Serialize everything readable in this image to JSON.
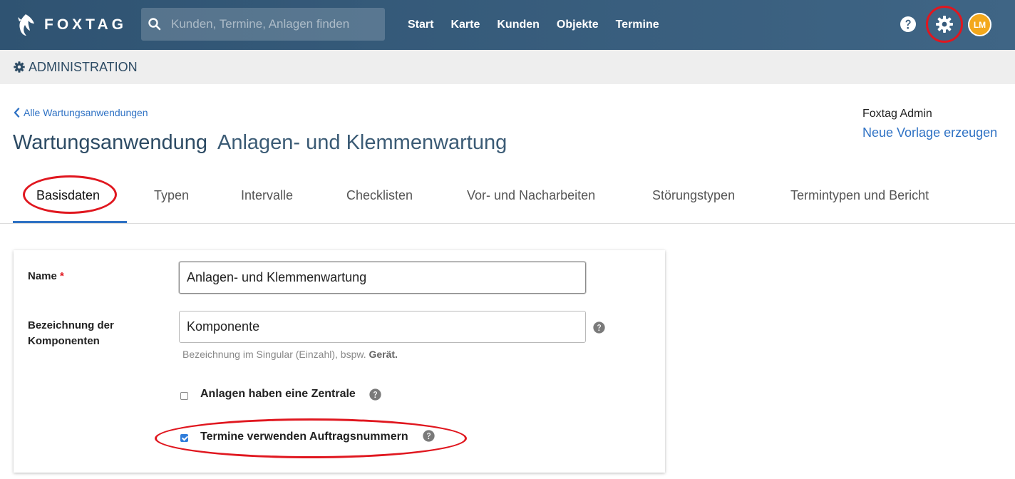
{
  "navbar": {
    "logo_text": "FOXTAG",
    "search_placeholder": "Kunden, Termine, Anlagen finden",
    "links": [
      "Start",
      "Karte",
      "Kunden",
      "Objekte",
      "Termine"
    ],
    "avatar_initials": "LM",
    "avatar_color": "#f3a81c"
  },
  "admin": {
    "title": "ADMINISTRATION"
  },
  "header": {
    "back_link": "Alle Wartungsanwendungen",
    "title_type": "Wartungsanwendung",
    "title_name": "Anlagen- und Klemmenwartung",
    "owner": "Foxtag Admin",
    "new_template": "Neue Vorlage erzeugen"
  },
  "tabs": [
    "Basisdaten",
    "Typen",
    "Intervalle",
    "Checklisten",
    "Vor- und Nacharbeiten",
    "Störungstypen",
    "Termintypen und Bericht"
  ],
  "active_tab": "Basisdaten",
  "form": {
    "name_label": "Name",
    "required_mark": "*",
    "name_value": "Anlagen- und Klemmenwartung",
    "component_label_line1": "Bezeichnung der",
    "component_label_line2": "Komponenten",
    "component_value": "Komponente",
    "component_hint_text": "Bezeichnung im Singular (Einzahl), bspw.",
    "component_hint_example": "Gerät.",
    "checkbox_central_label": "Anlagen haben eine Zentrale",
    "checkbox_central_checked": false,
    "checkbox_order_label": "Termine verwenden Auftragsnummern",
    "checkbox_order_checked": true
  },
  "colors": {
    "navbar": "#2f5372",
    "accent_blue": "#2f72c4",
    "highlight_red": "#e0171f"
  }
}
